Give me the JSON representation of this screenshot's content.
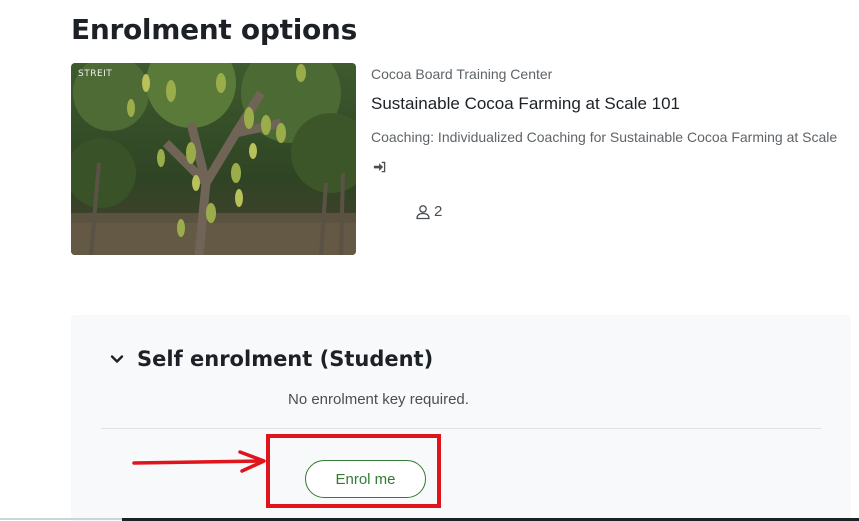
{
  "page": {
    "title": "Enrolment options"
  },
  "course": {
    "image_caption": "STREIT",
    "category": "Cocoa Board Training Center",
    "name": "Sustainable Cocoa Farming at Scale 101",
    "summary": "Coaching: Individualized Coaching for Sustainable Cocoa Farming at Scale",
    "guest_access_icon": "sign-in-icon",
    "participants_icon": "user-icon",
    "participants_count": "2"
  },
  "enrolment": {
    "section_title": "Self enrolment (Student)",
    "section_icon": "chevron-down-icon",
    "no_key_text": "No enrolment key required.",
    "enrol_button_label": "Enrol me",
    "accent_color": "#357a32"
  },
  "annotation": {
    "color": "#e0141b"
  }
}
